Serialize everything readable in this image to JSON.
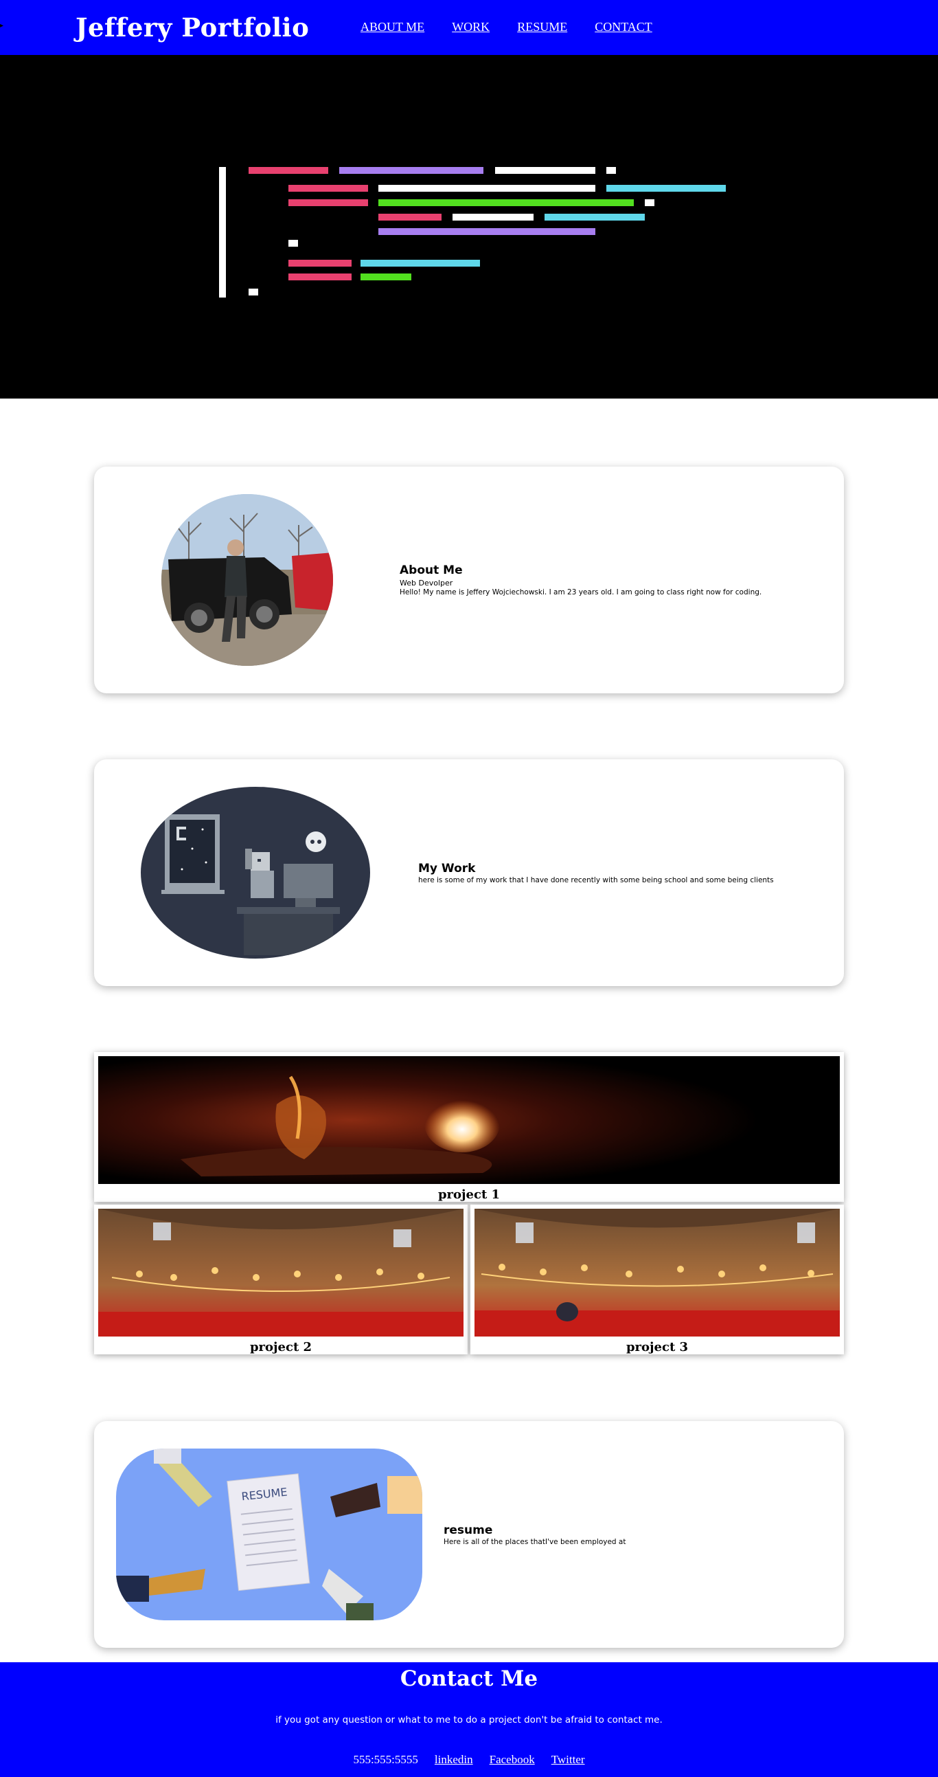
{
  "header": {
    "brand": "Jeffery Portfolio",
    "nav": [
      "ABOUT ME",
      "WORK",
      "RESUME",
      "CONTACT"
    ],
    "bg_color": "#0000ff"
  },
  "hero": {
    "image": "code-lines-graphic",
    "bg_color": "#000000"
  },
  "about": {
    "title": "About Me",
    "subtitle": "Web Devolper",
    "body": "Hello! My name is Jeffery Wojciechowski. I am 23 years old. I am going to class right now for coding.",
    "image": "portrait-photo-with-car"
  },
  "work": {
    "title": "My Work",
    "body": "here is some of my work that I have done recently with some being school and some being clients",
    "image": "developer-at-desk-illustration"
  },
  "projects": [
    {
      "label": "project 1",
      "image": "oil-lamp-photo"
    },
    {
      "label": "project 2",
      "image": "mosque-interior-photo"
    },
    {
      "label": "project 3",
      "image": "mosque-interior-photo"
    }
  ],
  "resume": {
    "title": "resume",
    "body": "Here is all of the places thatI've been employed at",
    "image": "resume-hands-illustration",
    "paper_label": "RESUME"
  },
  "footer": {
    "title": "Contact Me",
    "message": "if you got any question or what to me to do a project don't be afraid to contact me.",
    "phone": "555:555:5555",
    "links": [
      "linkedin",
      "Facebook",
      "Twitter"
    ],
    "bg_color": "#0000ff"
  }
}
